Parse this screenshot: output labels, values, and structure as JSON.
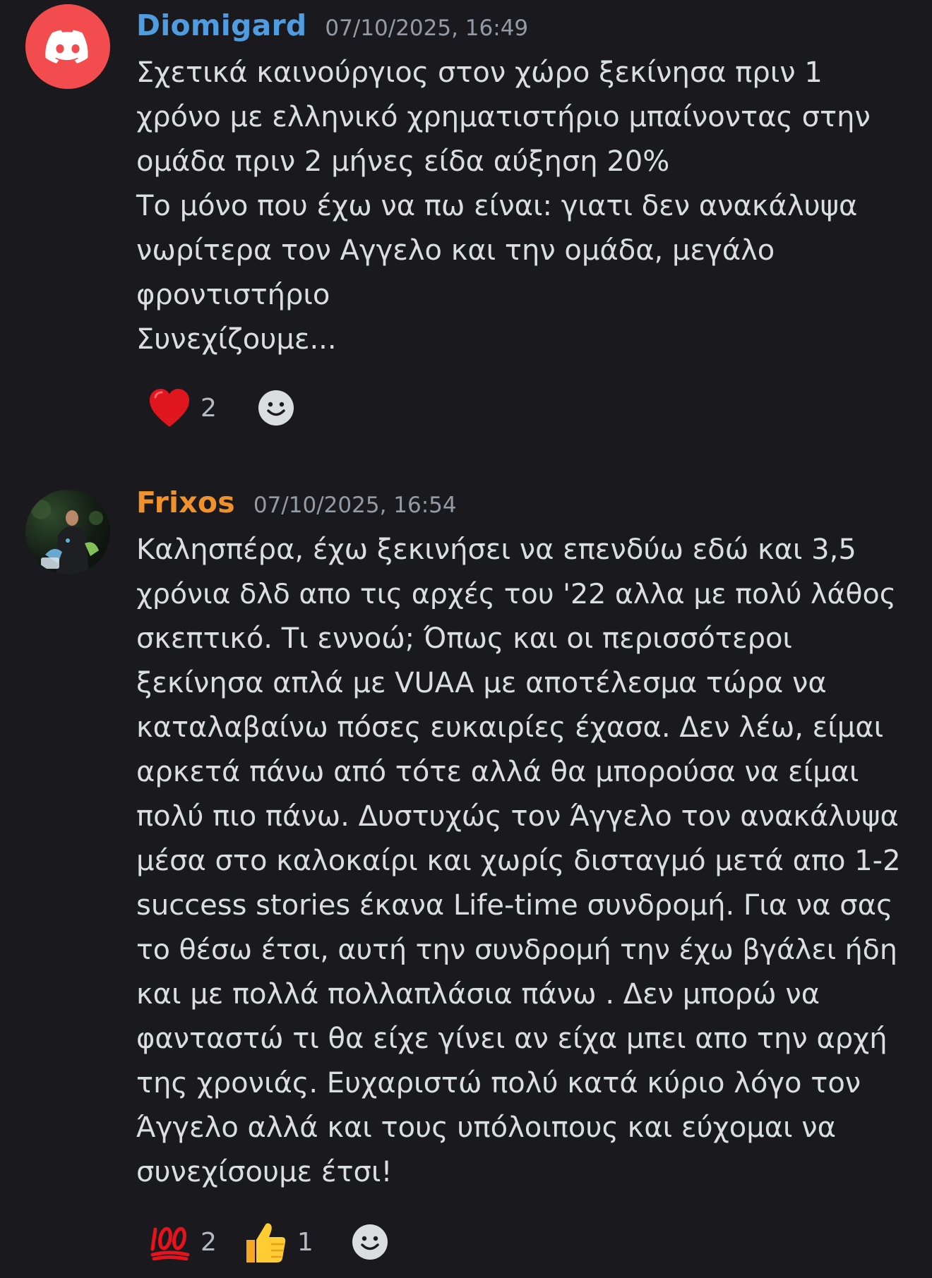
{
  "messages": [
    {
      "author": "Diomigard",
      "author_color": "#4f9ce0",
      "timestamp": "07/10/2025, 16:49",
      "avatar_icon": "discord-logo-icon",
      "lines": [
        "Σχετικά  καινούργιος  στον χώρο ξεκίνησα  πριν 1",
        "χρόνο  με ελληνικό χρηματιστήριο μπαίνοντας  στην",
        "ομάδα  πριν 2 μήνες  είδα αύξηση  20%",
        "Το μόνο που έχω να πω  είναι:  γιατι δεν ανακάλυψα",
        "νωρίτερα  τον Αγγελο και την ομάδα, μεγάλο",
        "φροντιστήριο",
        "Συνεχίζουμε..."
      ],
      "reactions": [
        {
          "icon": "red-heart-icon",
          "count": "2"
        }
      ],
      "add_reaction_icon": "add-reaction-smiley-icon"
    },
    {
      "author": "Frixos",
      "author_color": "#f0922b",
      "timestamp": "07/10/2025, 16:54",
      "avatar_icon": "user-photo-avatar",
      "lines": [
        "Καλησπέρα, έχω ξεκινήσει να επενδύω εδώ και 3,5",
        "χρόνια δλδ απο τις αρχές του '22 αλλα με πολύ λάθος",
        "σκεπτικό. Τι εννοώ; Όπως και οι περισσότεροι",
        "ξεκίνησα απλά με VUAA με αποτέλεσμα τώρα να",
        "καταλαβαίνω πόσες ευκαιρίες έχασα. Δεν λέω, είμαι",
        "αρκετά πάνω από τότε αλλά θα μπορούσα να είμαι",
        "πολύ πιο πάνω. Δυστυχώς τον Άγγελο τον ανακάλυψα",
        "μέσα στο καλοκαίρι και χωρίς δισταγμό μετά απο 1-2",
        "success stories έκανα Life-time συνδρομή. Για να σας",
        "το θέσω έτσι, αυτή την συνδρομή την έχω βγάλει ήδη",
        "και με πολλά πολλαπλάσια πάνω . Δεν μπορώ να",
        "φανταστώ τι θα είχε γίνει αν είχα μπει απο την αρχή",
        "της χρονιάς. Ευχαριστώ πολύ κατά κύριο λόγο τον",
        "Άγγελο αλλά και τους υπόλοιπους και εύχομαι να",
        "συνεχίσουμε έτσι!"
      ],
      "reactions": [
        {
          "icon": "hundred-points-icon",
          "count": "2"
        },
        {
          "icon": "thumbs-up-icon",
          "count": "1"
        }
      ],
      "add_reaction_icon": "add-reaction-smiley-icon"
    }
  ]
}
